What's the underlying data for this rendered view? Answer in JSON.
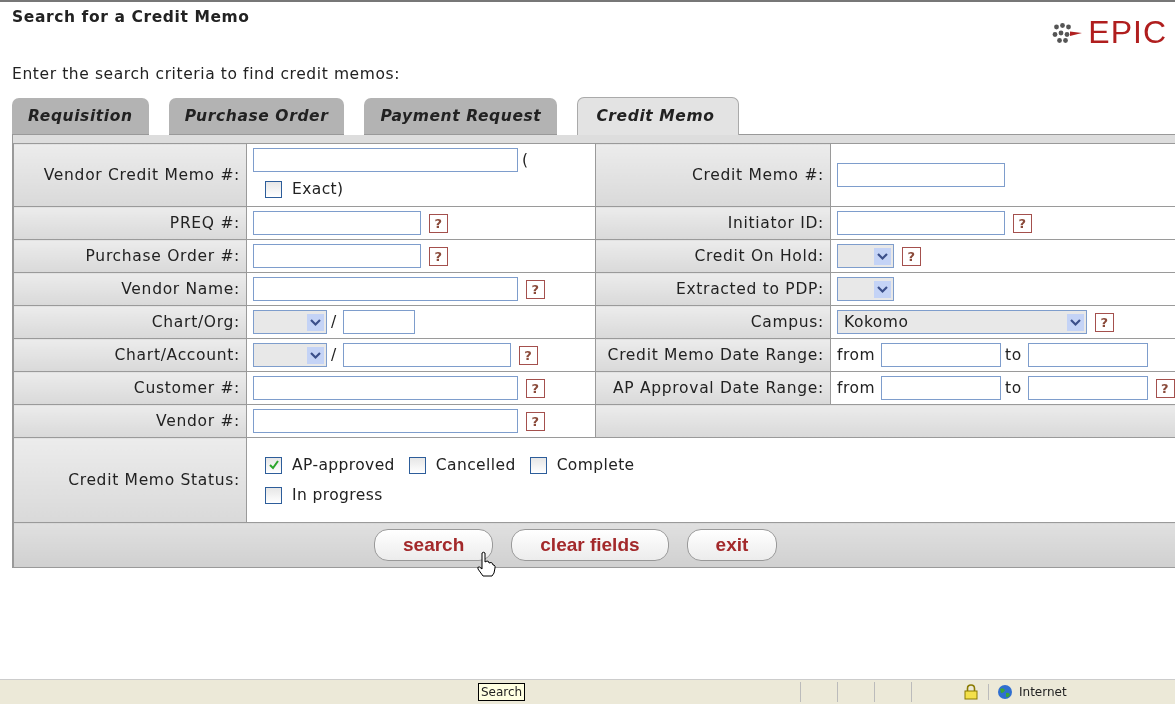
{
  "page": {
    "title": "Search for a Credit Memo",
    "logo": "EPIC",
    "instructions": "Enter the search criteria to find credit memos:"
  },
  "tabs": [
    {
      "label": "Requisition",
      "selected": false
    },
    {
      "label": "Purchase Order",
      "selected": false
    },
    {
      "label": "Payment Request",
      "selected": false
    },
    {
      "label": "Credit Memo",
      "selected": true
    }
  ],
  "rows": [
    {
      "left": {
        "label": "Vendor Credit Memo #:",
        "parts": [
          {
            "kind": "longfield"
          },
          {
            "kind": "text",
            "text": "("
          },
          {
            "kind": "break"
          },
          {
            "kind": "checkbox",
            "label": "Exact)",
            "checked": false
          }
        ]
      },
      "right": {
        "label": "Credit Memo #:",
        "parts": [
          {
            "kind": "field"
          }
        ]
      }
    },
    {
      "left": {
        "label": "PREQ #:",
        "parts": [
          {
            "kind": "field"
          },
          {
            "kind": "help",
            "text": "?"
          }
        ]
      },
      "right": {
        "label": "Initiator ID:",
        "parts": [
          {
            "kind": "field"
          },
          {
            "kind": "help",
            "text": "?"
          }
        ]
      }
    },
    {
      "left": {
        "label": "Purchase Order #:",
        "parts": [
          {
            "kind": "field"
          },
          {
            "kind": "help",
            "text": "?"
          }
        ]
      },
      "right": {
        "label": "Credit On Hold:",
        "parts": [
          {
            "kind": "dropdown"
          },
          {
            "kind": "help",
            "text": "?"
          }
        ]
      }
    },
    {
      "left": {
        "label": "Vendor Name:",
        "parts": [
          {
            "kind": "longfield"
          },
          {
            "kind": "help",
            "text": "?"
          }
        ]
      },
      "right": {
        "label": "Extracted to PDP:",
        "parts": [
          {
            "kind": "dropdown"
          }
        ]
      }
    },
    {
      "left": {
        "label": "Chart/Org:",
        "parts": [
          {
            "kind": "chartdropdown"
          },
          {
            "kind": "text",
            "text": "/"
          },
          {
            "kind": "shortfield"
          }
        ]
      },
      "right": {
        "label": "Campus:",
        "parts": [
          {
            "kind": "widedropdown",
            "value": "Kokomo"
          },
          {
            "kind": "help",
            "text": "?"
          }
        ]
      }
    },
    {
      "left": {
        "label": "Chart/Account:",
        "parts": [
          {
            "kind": "chartdropdown"
          },
          {
            "kind": "text",
            "text": "/"
          },
          {
            "kind": "field"
          },
          {
            "kind": "help",
            "text": "?"
          }
        ]
      },
      "right": {
        "label": "Credit Memo Date Range:",
        "parts": [
          {
            "kind": "text",
            "text": "from"
          },
          {
            "kind": "datefield"
          },
          {
            "kind": "text",
            "text": "to"
          },
          {
            "kind": "datefield"
          }
        ]
      }
    },
    {
      "left": {
        "label": "Customer #:",
        "parts": [
          {
            "kind": "longfield"
          },
          {
            "kind": "help",
            "text": "?"
          }
        ]
      },
      "right": {
        "label": "AP Approval Date Range:",
        "parts": [
          {
            "kind": "text",
            "text": "from"
          },
          {
            "kind": "datefield"
          },
          {
            "kind": "text",
            "text": "to"
          },
          {
            "kind": "datefield"
          },
          {
            "kind": "help",
            "text": "?"
          }
        ]
      }
    },
    {
      "left": {
        "label": "Vendor #:",
        "parts": [
          {
            "kind": "longfield"
          },
          {
            "kind": "help",
            "text": "?"
          }
        ]
      }
    }
  ],
  "status": {
    "label": "Credit Memo Status:",
    "options": [
      {
        "label": "AP-approved",
        "checked": true
      },
      {
        "label": "Cancelled",
        "checked": false
      },
      {
        "label": "Complete",
        "checked": false
      },
      {
        "label": "In progress",
        "checked": false
      }
    ]
  },
  "buttons": [
    "search",
    "clear fields",
    "exit"
  ],
  "tooltip": "Search",
  "status_bar": {
    "zone": "Internet"
  }
}
